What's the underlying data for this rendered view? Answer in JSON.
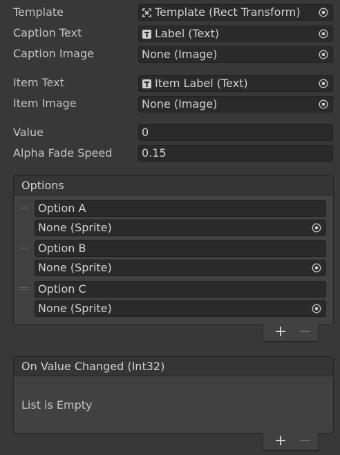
{
  "fields": {
    "template": {
      "label": "Template",
      "value": "Template (Rect Transform)",
      "icon": "rect-transform-icon"
    },
    "caption_text": {
      "label": "Caption Text",
      "value": "Label (Text)",
      "icon": "text-component-icon"
    },
    "caption_image": {
      "label": "Caption Image",
      "value": "None (Image)"
    },
    "item_text": {
      "label": "Item Text",
      "value": "Item Label (Text)",
      "icon": "text-component-icon"
    },
    "item_image": {
      "label": "Item Image",
      "value": "None (Image)"
    },
    "value": {
      "label": "Value",
      "value": "0"
    },
    "alpha_fade_speed": {
      "label": "Alpha Fade Speed",
      "value": "0.15"
    }
  },
  "options": {
    "title": "Options",
    "items": [
      {
        "text": "Option A",
        "sprite": "None (Sprite)"
      },
      {
        "text": "Option B",
        "sprite": "None (Sprite)"
      },
      {
        "text": "Option C",
        "sprite": "None (Sprite)"
      }
    ],
    "add_label": "+",
    "remove_label": "−"
  },
  "on_value_changed": {
    "title": "On Value Changed (Int32)",
    "empty_text": "List is Empty",
    "add_label": "+",
    "remove_label": "−"
  },
  "colors": {
    "background": "#383838",
    "field": "#2a2a2a",
    "text": "#c4c4c4"
  }
}
